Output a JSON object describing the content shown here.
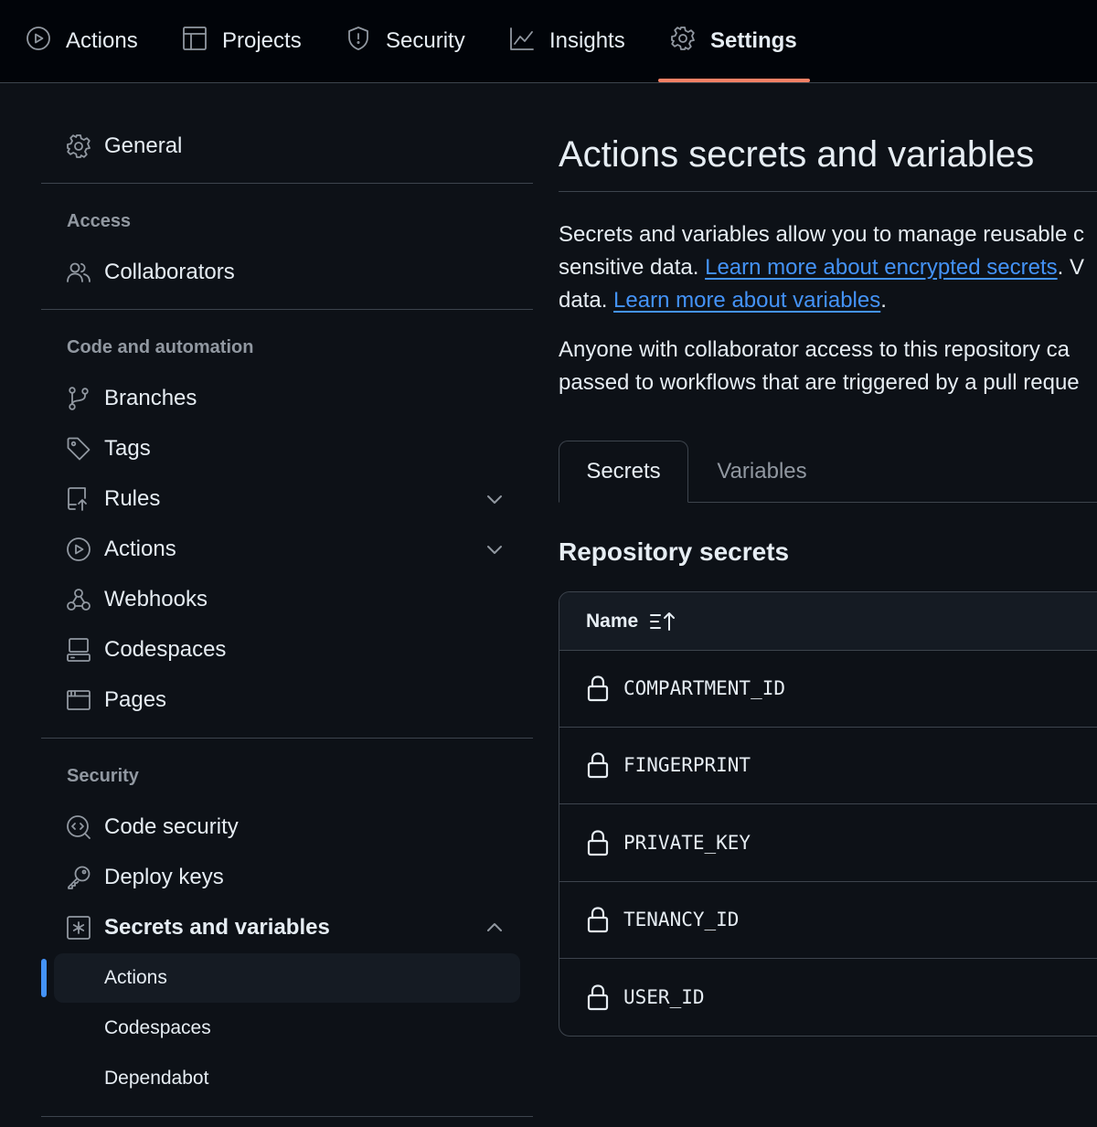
{
  "topnav": {
    "tabs": [
      {
        "label": "Actions",
        "icon": "play-circle-icon"
      },
      {
        "label": "Projects",
        "icon": "table-icon"
      },
      {
        "label": "Security",
        "icon": "shield-icon"
      },
      {
        "label": "Insights",
        "icon": "graph-icon"
      },
      {
        "label": "Settings",
        "icon": "gear-icon",
        "active": true
      }
    ],
    "underline_color": "#f78166"
  },
  "sidebar": {
    "general": "General",
    "access_heading": "Access",
    "collaborators": "Collaborators",
    "code_heading": "Code and automation",
    "code_items": [
      "Branches",
      "Tags",
      "Rules",
      "Actions",
      "Webhooks",
      "Codespaces",
      "Pages"
    ],
    "security_heading": "Security",
    "security_items": [
      "Code security",
      "Deploy keys",
      "Secrets and variables"
    ],
    "secrets_sub": [
      "Actions",
      "Codespaces",
      "Dependabot"
    ],
    "selected_sub": "Actions",
    "accent": "#4493f8"
  },
  "main": {
    "title": "Actions secrets and variables",
    "para1_line1": "Secrets and variables allow you to manage reusable c",
    "para1_line2_pre": "sensitive data. ",
    "para1_link1": "Learn more about encrypted secrets",
    "para1_line2_post": ". V",
    "para1_line3_pre": "data. ",
    "para1_link2": "Learn more about variables",
    "para1_line3_post": ".",
    "para2_line1": "Anyone with collaborator access to this repository ca",
    "para2_line2": "passed to workflows that are triggered by a pull reque",
    "tabs": {
      "secrets": "Secrets",
      "variables": "Variables"
    },
    "section_title": "Repository secrets",
    "table_header": "Name",
    "secrets": [
      "COMPARTMENT_ID",
      "FINGERPRINT",
      "PRIVATE_KEY",
      "TENANCY_ID",
      "USER_ID"
    ]
  }
}
